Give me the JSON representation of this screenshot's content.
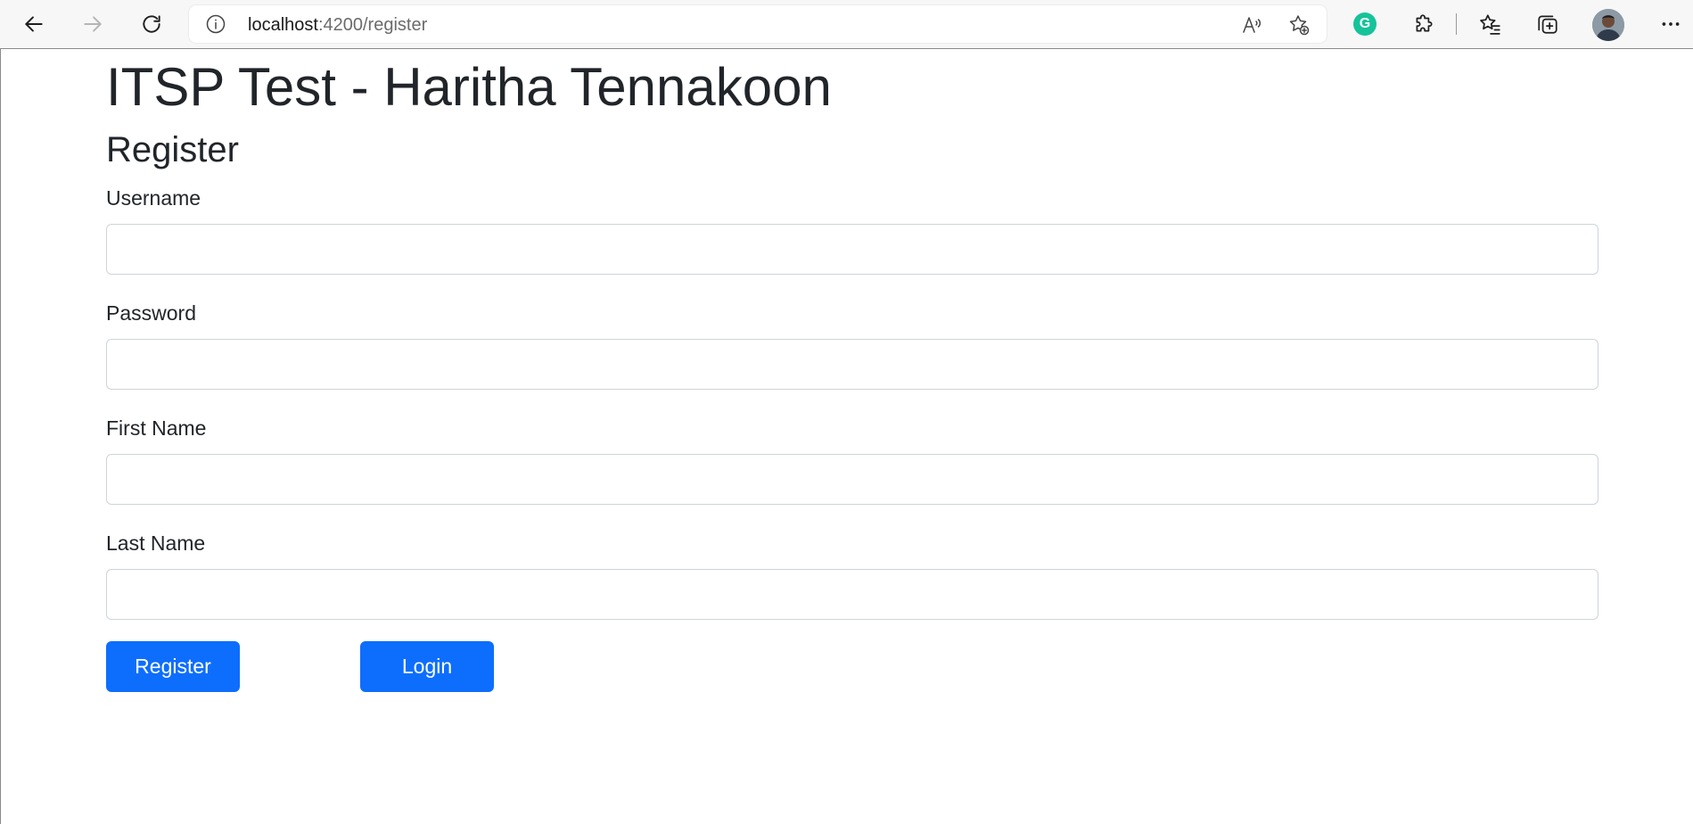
{
  "browser": {
    "url_host": "localhost",
    "url_path": ":4200/register",
    "icons": {
      "back": "arrow-left-icon",
      "forward": "arrow-right-icon",
      "refresh": "refresh-icon",
      "site_info": "info-icon",
      "read_aloud": "read-aloud-icon",
      "add_favorite": "star-add-icon",
      "grammarly": "grammarly-extension-icon",
      "extensions": "puzzle-icon",
      "favorites": "favorites-icon",
      "collections": "collections-icon",
      "profile": "avatar",
      "more": "more-icon"
    },
    "grammarly_letter": "G"
  },
  "app": {
    "title": "ITSP Test - Haritha Tennakoon"
  },
  "page": {
    "heading": "Register"
  },
  "form": {
    "username_label": "Username",
    "username_value": "",
    "password_label": "Password",
    "password_value": "",
    "first_name_label": "First Name",
    "first_name_value": "",
    "last_name_label": "Last Name",
    "last_name_value": "",
    "register_label": "Register",
    "login_label": "Login"
  },
  "colors": {
    "primary": "#0d6efd",
    "text": "#212529",
    "input_border": "#ced4da",
    "grammarly": "#15c39a"
  }
}
